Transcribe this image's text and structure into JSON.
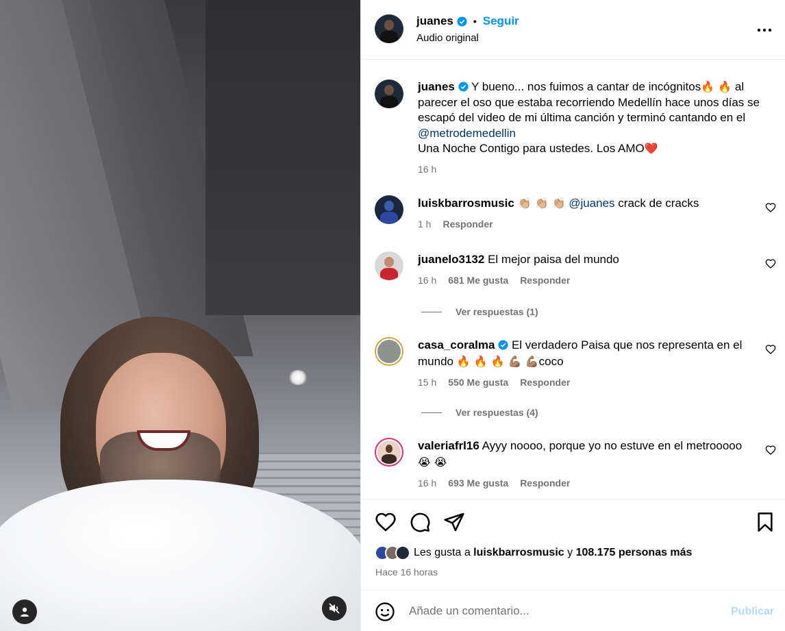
{
  "colors": {
    "accent": "#0095f6",
    "link": "#00376b",
    "muted": "#737373",
    "publish_disabled": "#b3dbff"
  },
  "media": {
    "type": "video",
    "icons": {
      "user": "user-icon",
      "mute": "speaker-muted-icon"
    }
  },
  "header": {
    "username": "juanes",
    "verified": true,
    "separator": "•",
    "follow_label": "Seguir",
    "subtitle": "Audio original",
    "more_icon": "more-horizontal-icon"
  },
  "caption": {
    "username": "juanes",
    "text_part1": "Y bueno... nos fuimos a cantar de incógnitos",
    "emoji1": "🔥 🔥",
    "text_part2": " al parecer el oso que estaba recorriendo Medellín hace unos días se escapó del video de mi última canción y terminó cantando en el ",
    "mention": "@metrodemedellin",
    "text_part3": "Una Noche Contigo para ustedes. Los AMO",
    "emoji2": "❤️",
    "time": "16 h"
  },
  "comments": [
    {
      "username": "luiskbarrosmusic",
      "emoji": "👏🏼 👏🏼 👏🏼",
      "mention": "@juanes",
      "text": "crack de cracks",
      "time": "1 h",
      "likes": "",
      "reply_label": "Responder"
    },
    {
      "username": "juanelo3132",
      "text": "El mejor paisa del mundo",
      "time": "16 h",
      "likes": "681 Me gusta",
      "reply_label": "Responder",
      "view_replies": "Ver respuestas (1)"
    },
    {
      "username": "casa_coralma",
      "verified": true,
      "text": "El verdadero Paisa que nos representa en el mundo",
      "emoji": "🔥 🔥 🔥 💪🏽 💪🏽",
      "text_end": "coco",
      "time": "15 h",
      "likes": "550 Me gusta",
      "reply_label": "Responder",
      "view_replies": "Ver respuestas (4)"
    },
    {
      "username": "valeriafrl16",
      "text": "Ayyy noooo, porque yo no estuve en el metrooooo",
      "emoji": "😭 😭",
      "time": "16 h",
      "likes": "693 Me gusta",
      "reply_label": "Responder"
    }
  ],
  "actions": {
    "icons": [
      "heart-icon",
      "comment-icon",
      "share-icon",
      "save-icon"
    ],
    "likes_prefix": "Les gusta a ",
    "likes_user": "luiskbarrosmusic",
    "likes_middle": " y ",
    "likes_count": "108.175 personas más",
    "time_ago": "Hace 16 horas"
  },
  "comment_box": {
    "placeholder": "Añade un comentario...",
    "publish_label": "Publicar",
    "emoji_icon": "smile-icon"
  }
}
